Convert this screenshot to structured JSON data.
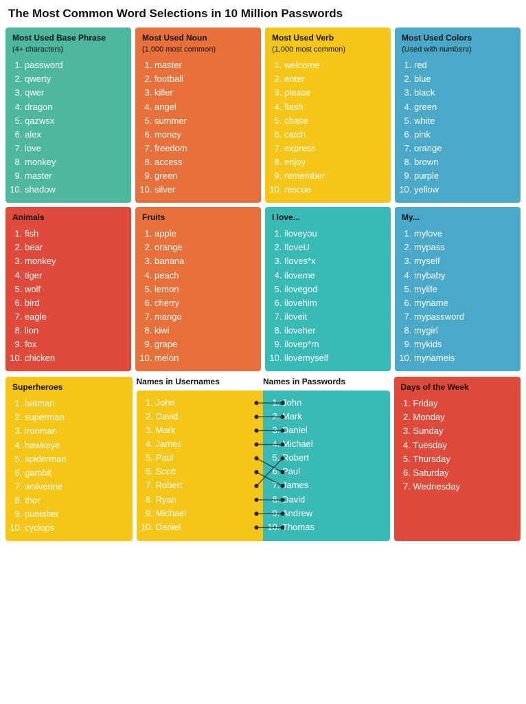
{
  "title": "The Most Common Word Selections in 10 Million Passwords",
  "sections": {
    "base_phrase": {
      "title": "Most Used Base Phrase",
      "subtitle": "(4+ characters)",
      "color": "green",
      "items": [
        "password",
        "qwerty",
        "qwer",
        "dragon",
        "qazwsx",
        "alex",
        "love",
        "monkey",
        "master",
        "shadow"
      ]
    },
    "noun": {
      "title": "Most Used Noun",
      "subtitle": "(1,000 most common)",
      "color": "orange",
      "items": [
        "master",
        "football",
        "killer",
        "angel",
        "summer",
        "money",
        "freedom",
        "access",
        "green",
        "silver"
      ]
    },
    "verb": {
      "title": "Most Used Verb",
      "subtitle": "(1,000 most common)",
      "color": "yellow",
      "items": [
        "welcome",
        "enter",
        "please",
        "flash",
        "chase",
        "catch",
        "express",
        "enjoy",
        "remember",
        "rescue"
      ]
    },
    "colors": {
      "title": "Most Used Colors",
      "subtitle": "(Used with numbers)",
      "color": "blue",
      "items": [
        "red",
        "blue",
        "black",
        "green",
        "white",
        "pink",
        "orange",
        "brown",
        "purple",
        "yellow"
      ]
    },
    "animals": {
      "title": "Animals",
      "color": "red",
      "items": [
        "fish",
        "bear",
        "monkey",
        "tiger",
        "wolf",
        "bird",
        "eagle",
        "lion",
        "fox",
        "chicken"
      ]
    },
    "fruits": {
      "title": "Fruits",
      "color": "orange",
      "items": [
        "apple",
        "orange",
        "banana",
        "peach",
        "lemon",
        "cherry",
        "mango",
        "kiwi",
        "grape",
        "melon"
      ]
    },
    "ilove": {
      "title": "I love...",
      "color": "teal",
      "items": [
        "iloveyou",
        "IloveU",
        "Iloves*x",
        "iloveme",
        "ilovegod",
        "ilovehim",
        "iloveit",
        "iloveher",
        "ilovep*rn",
        "ilovemyself"
      ]
    },
    "my": {
      "title": "My...",
      "color": "blue",
      "items": [
        "mylove",
        "mypass",
        "myself",
        "mybaby",
        "mylife",
        "myname",
        "mypassword",
        "mygirl",
        "mykids",
        "mynameis"
      ]
    },
    "superheroes": {
      "title": "Superheroes",
      "color": "yellow",
      "items": [
        "batman",
        "superman",
        "ironman",
        "hawkeye",
        "spiderman",
        "gambit",
        "wolverine",
        "thor",
        "punisher",
        "cyclops"
      ]
    },
    "names_usernames": {
      "title": "Names in Usernames",
      "items": [
        "John",
        "David",
        "Mark",
        "James",
        "Paul",
        "Scott",
        "Robert",
        "Ryan",
        "Michael",
        "Daniel"
      ]
    },
    "names_passwords": {
      "title": "Names in Passwords",
      "items": [
        "John",
        "Mark",
        "Daniel",
        "Michael",
        "Robert",
        "Paul",
        "James",
        "David",
        "Andrew",
        "Thomas"
      ]
    },
    "days": {
      "title": "Days of the Week",
      "color": "red",
      "items": [
        "Friday",
        "Monday",
        "Sunday",
        "Tuesday",
        "Thursday",
        "Saturday",
        "Wednesday"
      ]
    }
  },
  "names_lines": [
    {
      "from": 0,
      "to": 0
    },
    {
      "from": 1,
      "to": 1
    },
    {
      "from": 2,
      "to": 2
    },
    {
      "from": 3,
      "to": 3
    },
    {
      "from": 4,
      "to": 5
    },
    {
      "from": 5,
      "to": 6
    },
    {
      "from": 6,
      "to": 4
    },
    {
      "from": 7,
      "to": 7
    },
    {
      "from": 8,
      "to": 8
    },
    {
      "from": 9,
      "to": 9
    }
  ]
}
